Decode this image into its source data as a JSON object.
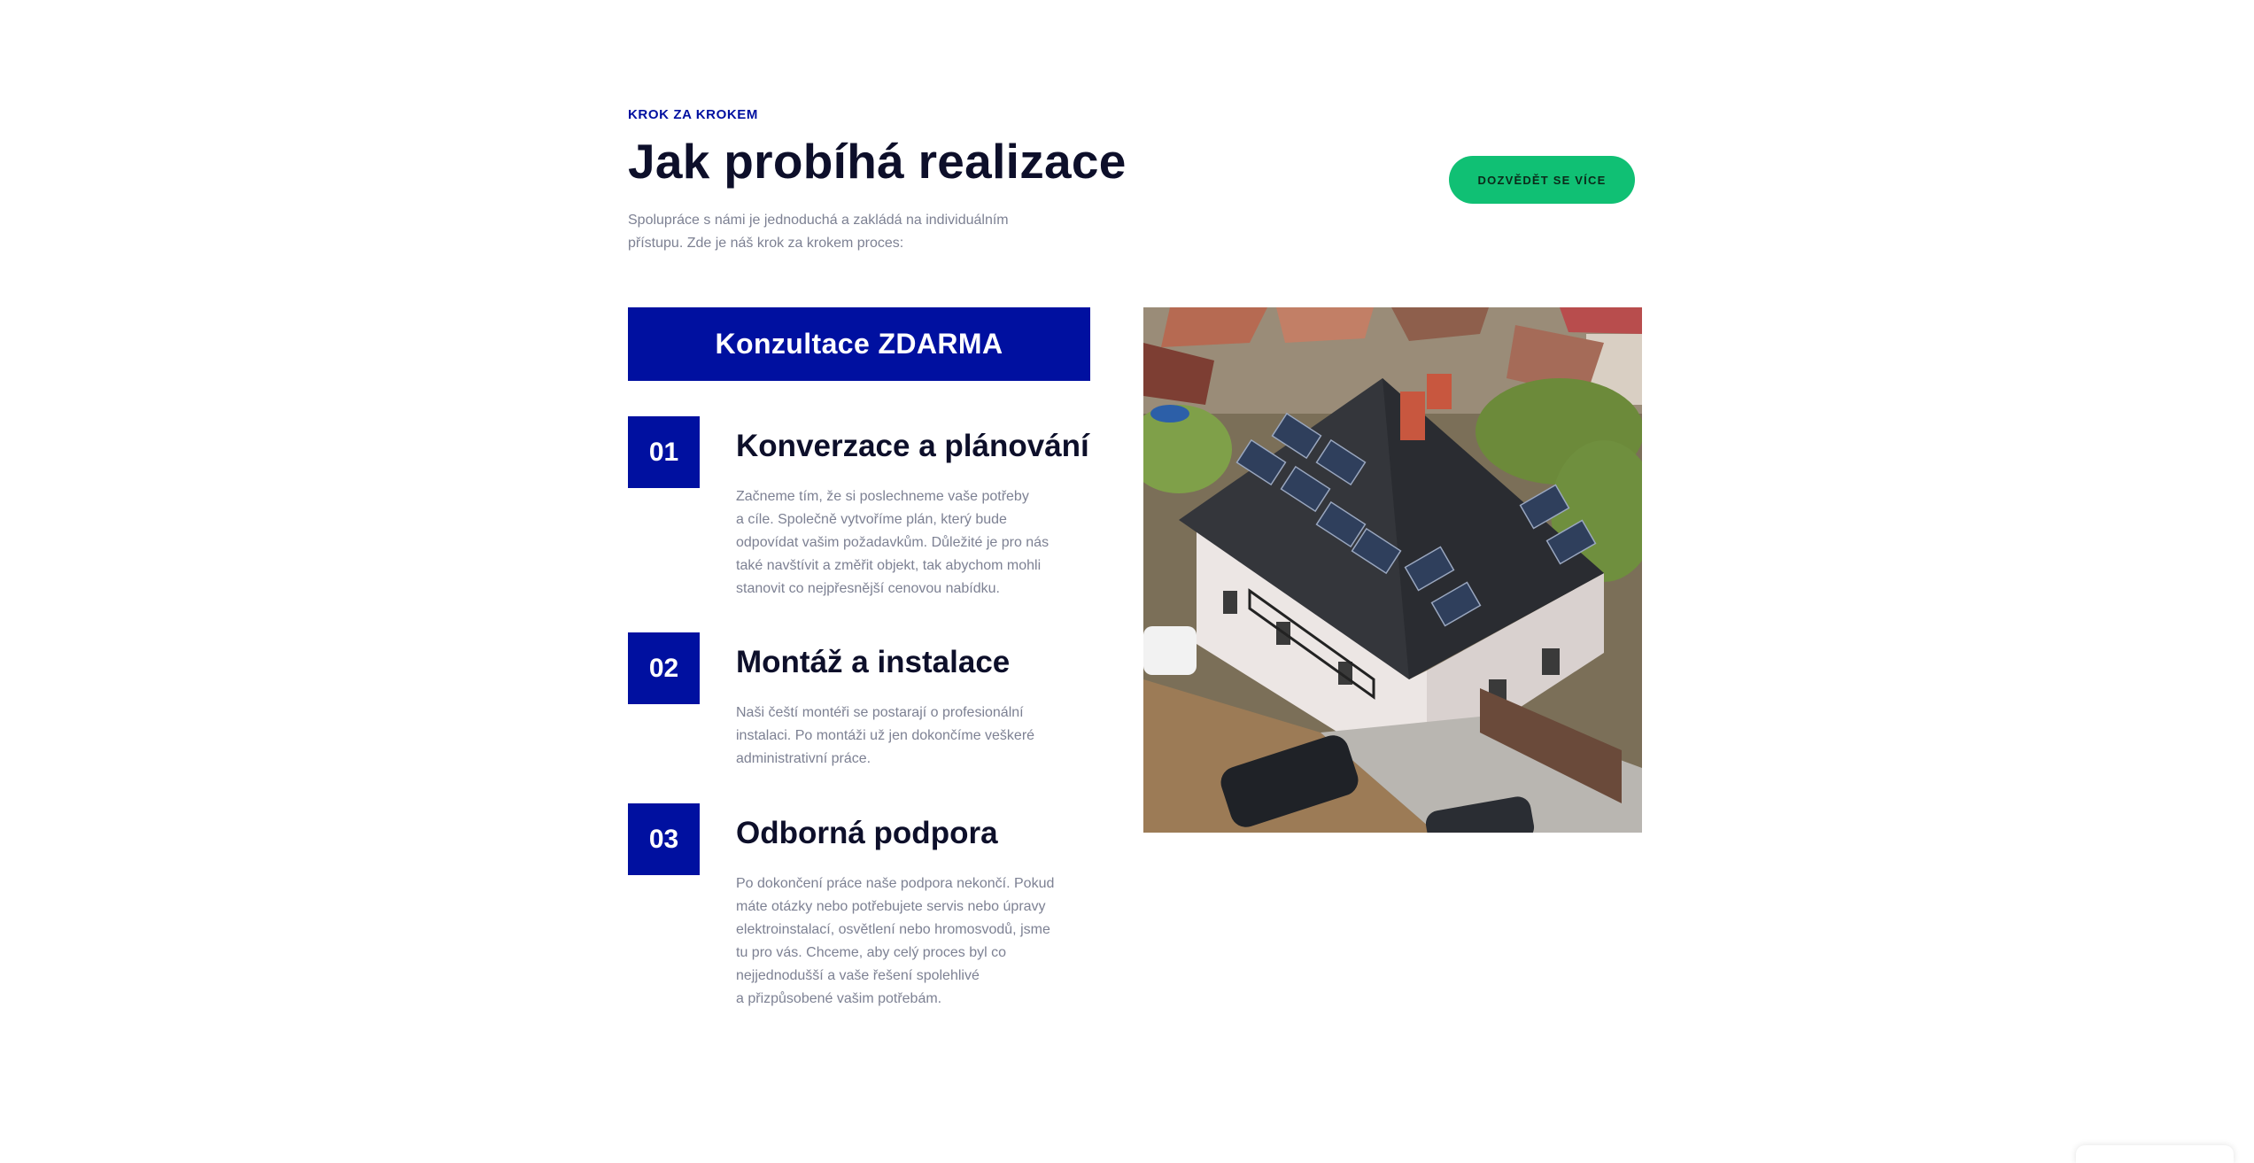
{
  "section": {
    "eyebrow": "KROK ZA KROKEM",
    "title": "Jak probíhá realizace",
    "intro_lines": [
      "Spolupráce s námi je jednoduchá a zakládá na individuálním",
      "přístupu. Zde je náš krok za krokem proces:"
    ],
    "cta_label": "DOZVĚDĚT SE VÍCE",
    "banner": "Konzultace ZDARMA"
  },
  "steps": [
    {
      "number": "01",
      "title": "Konverzace a plánování",
      "lines": [
        "Začneme tím, že si poslechneme vaše potřeby",
        "a cíle. Společně vytvoříme plán, který bude",
        "odpovídat vašim požadavkům. Důležité je pro nás",
        "také navštívit a změřit objekt, tak abychom mohli",
        "stanovit co nejpřesnější cenovou nabídku."
      ]
    },
    {
      "number": "02",
      "title": "Montáž a instalace",
      "lines": [
        "Naši čeští montéři se postarají o profesionální",
        "instalaci. Po montáži už jen dokončíme veškeré",
        "administrativní práce."
      ]
    },
    {
      "number": "03",
      "title": "Odborná podpora",
      "lines": [
        "Po dokončení práce naše podpora nekončí. Pokud",
        "máte otázky nebo potřebujete servis nebo úpravy",
        "elektroinstalací, osvětlení nebo hromosvodů, jsme",
        "tu pro vás. Chceme, aby celý proces byl co",
        "nejjednodušší a vaše řešení spolehlivé",
        "a přizpůsobené vašim potřebám."
      ]
    }
  ],
  "image": {
    "subject": "house-with-solar-panels-aerial-photo"
  },
  "colors": {
    "brand_blue": "#0010a0",
    "cta_green": "#10c074",
    "heading": "#0d0f2a",
    "body_text": "#7d8193"
  }
}
